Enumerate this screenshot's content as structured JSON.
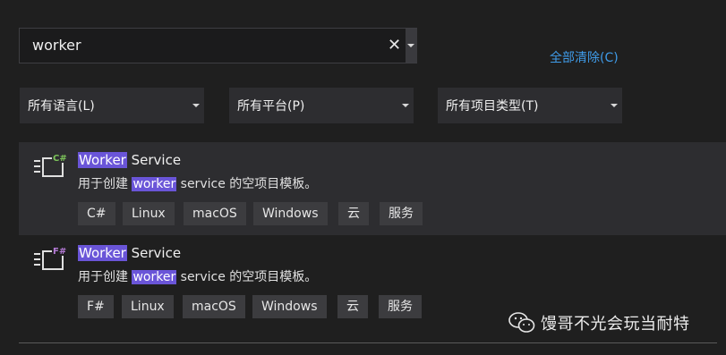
{
  "search": {
    "value": "worker"
  },
  "clear_all_label": "全部清除(C)",
  "filters": [
    {
      "label": "所有语言(L)"
    },
    {
      "label": "所有平台(P)"
    },
    {
      "label": "所有项目类型(T)"
    }
  ],
  "results": [
    {
      "title_highlight": "Worker",
      "title_rest": " Service",
      "desc_prefix": "用于创建 ",
      "desc_highlight": "worker",
      "desc_suffix": " service 的空项目模板。",
      "lang_badge": "C#",
      "tags": [
        "C#",
        "Linux",
        "macOS",
        "Windows",
        "云",
        "服务"
      ],
      "selected": true
    },
    {
      "title_highlight": "Worker",
      "title_rest": " Service",
      "desc_prefix": "用于创建 ",
      "desc_highlight": "worker",
      "desc_suffix": " service 的空项目模板。",
      "lang_badge": "F#",
      "tags": [
        "F#",
        "Linux",
        "macOS",
        "Windows",
        "云",
        "服务"
      ],
      "selected": false
    }
  ],
  "watermark": "馒哥不光会玩当耐特",
  "colors": {
    "highlight": "#6a55d8",
    "link": "#3f9be8",
    "csharp": "#7cc35a",
    "fsharp": "#b47ad6"
  }
}
